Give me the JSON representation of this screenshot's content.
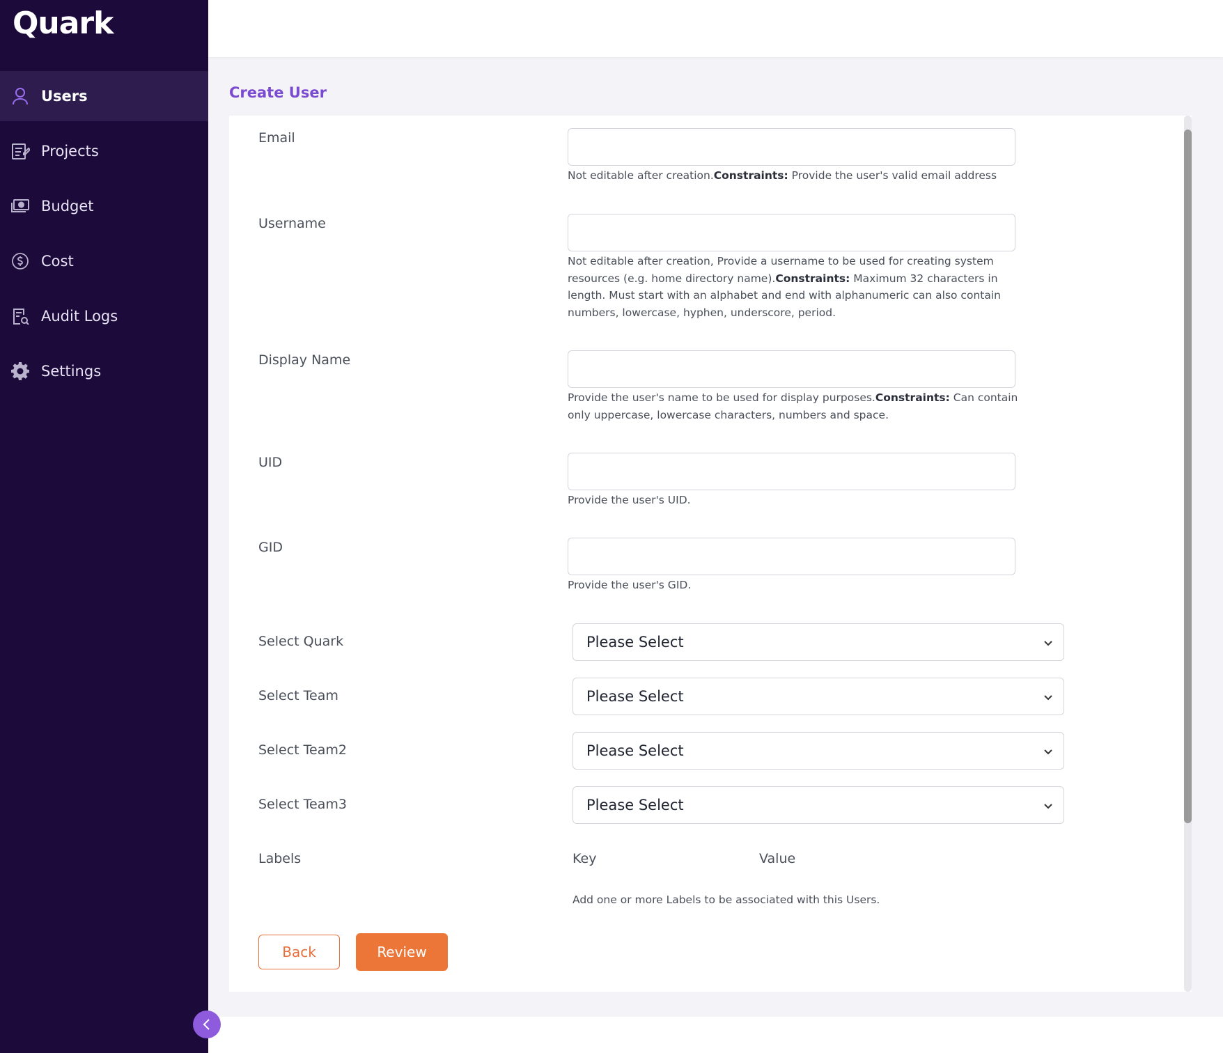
{
  "app": {
    "logo": "Quark"
  },
  "sidebar": {
    "items": [
      {
        "label": "Users",
        "icon": "user-icon",
        "active": true
      },
      {
        "label": "Projects",
        "icon": "edit-document-icon"
      },
      {
        "label": "Budget",
        "icon": "money-icon"
      },
      {
        "label": "Cost",
        "icon": "dollar-circle-icon"
      },
      {
        "label": "Audit Logs",
        "icon": "document-search-icon"
      },
      {
        "label": "Settings",
        "icon": "gear-icon"
      }
    ]
  },
  "page": {
    "title": "Create User"
  },
  "form": {
    "email": {
      "label": "Email",
      "value": "",
      "help_prefix": "Not editable after creation.",
      "help_bold": "Constraints:",
      "help_suffix": " Provide the user's valid email address"
    },
    "username": {
      "label": "Username",
      "value": "",
      "help_prefix": "Not editable after creation, Provide a username to be used for creating system resources (e.g. home directory name).",
      "help_bold": "Constraints:",
      "help_suffix": " Maximum 32 characters in length. Must start with an alphabet and end with alphanumeric can also contain numbers, lowercase, hyphen, underscore, period."
    },
    "display_name": {
      "label": "Display Name",
      "value": "",
      "help_prefix": "Provide the user's name to be used for display purposes.",
      "help_bold": "Constraints:",
      "help_suffix": " Can contain only uppercase, lowercase characters, numbers and space."
    },
    "uid": {
      "label": "UID",
      "value": "",
      "help": "Provide the user's UID."
    },
    "gid": {
      "label": "GID",
      "value": "",
      "help": "Provide the user's GID."
    },
    "selects": [
      {
        "label": "Select Quark",
        "value": "Please Select"
      },
      {
        "label": "Select Team",
        "value": "Please Select"
      },
      {
        "label": "Select Team2",
        "value": "Please Select"
      },
      {
        "label": "Select Team3",
        "value": "Please Select"
      }
    ],
    "labels": {
      "label": "Labels",
      "key_header": "Key",
      "value_header": "Value",
      "help": "Add one or more Labels to be associated with this Users."
    }
  },
  "actions": {
    "back": "Back",
    "review": "Review"
  },
  "colors": {
    "sidebar_bg": "#1b0a3a",
    "accent_purple": "#7a4bd0",
    "accent_orange": "#ec7538"
  }
}
